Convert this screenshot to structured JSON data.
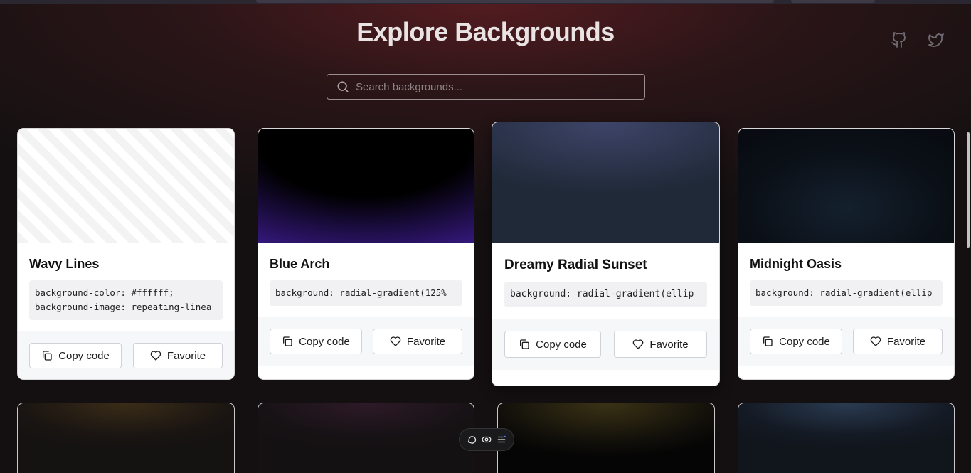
{
  "header": {
    "title": "Explore Backgrounds"
  },
  "search": {
    "placeholder": "Search backgrounds...",
    "value": ""
  },
  "social": {
    "github_icon": "github-icon",
    "twitter_icon": "twitter-icon"
  },
  "cards": [
    {
      "name": "Wavy Lines",
      "code": "background-color: #ffffff;\nbackground-image: repeating-linea",
      "copy_label": "Copy code",
      "favorite_label": "Favorite"
    },
    {
      "name": "Blue Arch",
      "code": "background: radial-gradient(125%",
      "copy_label": "Copy code",
      "favorite_label": "Favorite"
    },
    {
      "name": "Dreamy Radial Sunset",
      "code": "background: radial-gradient(ellip",
      "copy_label": "Copy code",
      "favorite_label": "Favorite"
    },
    {
      "name": "Midnight Oasis",
      "code": "background: radial-gradient(ellip",
      "copy_label": "Copy code",
      "favorite_label": "Favorite"
    }
  ],
  "toolbar": {
    "icons": [
      "comment-icon",
      "toggle-icon",
      "menu-icon"
    ]
  },
  "colors": {
    "page_bg": "#141011",
    "header_glow": "#5f1e23",
    "card_bg": "#ffffff",
    "card_footer": "#f6f7f9"
  }
}
